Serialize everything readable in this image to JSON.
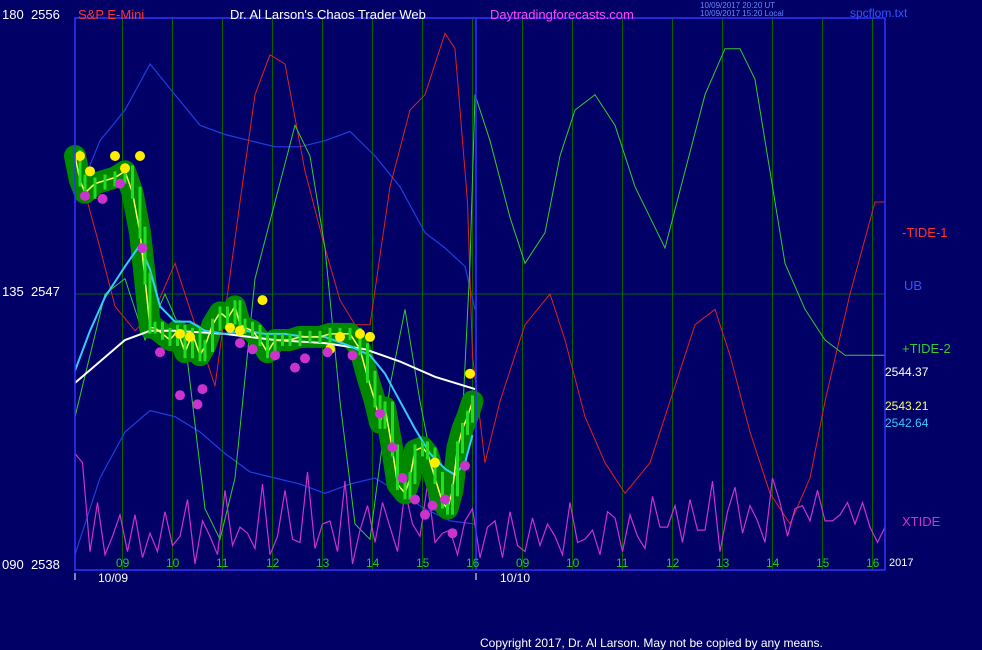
{
  "header": {
    "symbol": "S&P E-Mini",
    "publisher": "Dr. Al Larson's Chaos Trader Web",
    "site": "Daytradingforecasts.com",
    "timestamp_ut": "10/09/2017 20:20 UT",
    "timestamp_local": "10/09/2017 15:20 Local",
    "filename": "spcflom.txt"
  },
  "footer": {
    "copyright": "Copyright 2017, Dr. Al Larson. May not be copied by any means."
  },
  "colors": {
    "background": "#000066",
    "grid": "#006600",
    "frame": "#3333ff",
    "tide1": "#dd2222",
    "ub": "#1f3fdd",
    "tide2": "#33cc33",
    "xtide": "#cc33cc",
    "white_avg": "#ffffff",
    "cyan_avg": "#33ccff",
    "price": "#ffff66",
    "dot_up": "#ffee00",
    "dot_down": "#cc33cc",
    "halo": "#008800"
  },
  "chart_data": {
    "type": "line",
    "title": "S&P E-Mini",
    "y_left_ticks": [
      {
        "angle": "180",
        "price": "2556",
        "value": 2556
      },
      {
        "angle": "135",
        "price": "2547",
        "value": 2547
      },
      {
        "angle": "090",
        "price": "2538",
        "value": 2538
      }
    ],
    "ylim": [
      2538,
      2556
    ],
    "x_hour_labels": [
      "09",
      "10",
      "11",
      "12",
      "13",
      "14",
      "15",
      "16",
      "09",
      "10",
      "11",
      "12",
      "13",
      "14",
      "15",
      "16"
    ],
    "x_date_labels": [
      "10/09",
      "10/10"
    ],
    "x_end_label": "2017",
    "xlim": [
      0,
      16.2
    ],
    "series_labels": {
      "tide1": "-TIDE-1",
      "ub": "UB",
      "tide2": "+TIDE-2",
      "xtide": "XTIDE"
    },
    "price_labels": [
      {
        "text": "2544.37",
        "color": "#ffffff",
        "value": 2544.37
      },
      {
        "text": "2543.21",
        "color": "#ffff66",
        "value": 2543.21
      },
      {
        "text": "2542.64",
        "color": "#33ccff",
        "value": 2542.64
      }
    ],
    "series": {
      "price": {
        "x": [
          0,
          0.1,
          0.2,
          0.4,
          0.6,
          0.8,
          1.0,
          1.15,
          1.3,
          1.4,
          1.5,
          1.6,
          1.75,
          1.9,
          2.05,
          2.2,
          2.35,
          2.5,
          2.6,
          2.75,
          2.9,
          3.05,
          3.2,
          3.3,
          3.4,
          3.55,
          3.7,
          3.85,
          4.0,
          4.15,
          4.3,
          4.5,
          4.7,
          4.9,
          5.1,
          5.3,
          5.5,
          5.7,
          5.85,
          6.0,
          6.1,
          6.2,
          6.35,
          6.45,
          6.6,
          6.7,
          6.8,
          6.95,
          7.05,
          7.2,
          7.35,
          7.45,
          7.55,
          7.65,
          7.75,
          7.85,
          7.95
        ],
        "y": [
          2551.5,
          2550.7,
          2550.3,
          2550.6,
          2550.7,
          2550.8,
          2551.0,
          2550.3,
          2549.0,
          2547.5,
          2545.9,
          2545.9,
          2545.7,
          2545.5,
          2545.8,
          2545.1,
          2545.7,
          2545.0,
          2545.3,
          2546.0,
          2546.4,
          2546.2,
          2546.6,
          2546.0,
          2545.9,
          2545.8,
          2545.5,
          2545.1,
          2545.5,
          2545.5,
          2545.5,
          2545.6,
          2545.6,
          2545.6,
          2545.7,
          2545.7,
          2545.7,
          2545.2,
          2544.3,
          2543.5,
          2542.8,
          2543.3,
          2541.9,
          2540.8,
          2540.5,
          2541.0,
          2541.9,
          2542.0,
          2541.8,
          2541.0,
          2540.2,
          2540.0,
          2540.6,
          2542.0,
          2542.6,
          2543.0,
          2543.5
        ]
      },
      "white_avg": {
        "x": [
          0,
          0.5,
          1.0,
          1.5,
          2.0,
          3.0,
          4.0,
          5.0,
          5.8,
          6.5,
          7.2,
          8.0
        ],
        "y": [
          2544.1,
          2544.8,
          2545.5,
          2545.8,
          2545.8,
          2545.7,
          2545.5,
          2545.4,
          2545.2,
          2544.8,
          2544.3,
          2543.9
        ]
      },
      "cyan_avg": {
        "x": [
          0,
          0.3,
          0.6,
          1.0,
          1.3,
          1.5,
          1.7,
          2.0,
          2.3,
          2.6,
          3.0,
          3.4,
          3.8,
          4.2,
          4.6,
          5.0,
          5.5,
          5.9,
          6.2,
          6.5,
          6.8,
          7.1,
          7.4,
          7.6,
          7.8,
          7.95
        ],
        "y": [
          2544.5,
          2545.8,
          2546.9,
          2547.9,
          2548.6,
          2547.8,
          2546.6,
          2546.1,
          2546.1,
          2545.8,
          2545.7,
          2545.8,
          2545.7,
          2545.7,
          2545.6,
          2545.6,
          2545.3,
          2545.0,
          2544.4,
          2543.5,
          2542.6,
          2541.8,
          2541.3,
          2541.1,
          2541.5,
          2542.4
        ]
      },
      "yellow_up_dots": {
        "x": [
          0.1,
          0.3,
          0.8,
          1.0,
          1.3,
          2.1,
          2.3,
          3.1,
          3.3,
          3.75,
          5.1,
          5.3,
          5.7,
          5.9,
          7.2,
          7.9
        ],
        "y": [
          2551.5,
          2551.0,
          2551.5,
          2551.1,
          2551.5,
          2545.7,
          2545.6,
          2545.9,
          2545.8,
          2546.8,
          2545.2,
          2545.6,
          2545.7,
          2545.6,
          2541.5,
          2544.4
        ]
      },
      "magenta_down_dots": {
        "x": [
          0.2,
          0.55,
          0.9,
          1.35,
          1.7,
          2.1,
          2.45,
          2.55,
          3.3,
          3.55,
          4.0,
          4.4,
          4.6,
          5.05,
          5.55,
          6.1,
          6.35,
          6.55,
          6.8,
          7.0,
          7.15,
          7.4,
          7.55,
          7.8
        ],
        "y": [
          2550.2,
          2550.1,
          2550.6,
          2548.5,
          2545.1,
          2543.7,
          2543.4,
          2543.9,
          2545.4,
          2545.2,
          2545.0,
          2544.6,
          2544.9,
          2545.1,
          2545.0,
          2543.1,
          2542.0,
          2541.0,
          2540.3,
          2539.8,
          2540.1,
          2540.3,
          2539.2,
          2541.4
        ]
      },
      "tide1": {
        "x": [
          0,
          0.25,
          0.5,
          0.8,
          1.2,
          1.6,
          2.0,
          2.4,
          2.8,
          3.3,
          3.6,
          3.9,
          4.2,
          4.6,
          5.0,
          5.3,
          5.6,
          5.9,
          6.3,
          6.7,
          7.0,
          7.4,
          7.6,
          7.85,
          7.95,
          8.2,
          8.5,
          9.0,
          9.5,
          9.8,
          10.2,
          10.6,
          11.0,
          11.5,
          12.0,
          12.4,
          12.8,
          13.1,
          13.5,
          13.9,
          14.3,
          14.7,
          15.0,
          15.5,
          16.0,
          16.2
        ],
        "y": [
          2551.0,
          2550.0,
          2548.5,
          2546.6,
          2545.8,
          2546.5,
          2548.0,
          2546.0,
          2544.0,
          2550.0,
          2553.5,
          2554.8,
          2554.5,
          2551.0,
          2548.5,
          2546.8,
          2546.0,
          2546.0,
          2550.5,
          2553.0,
          2553.5,
          2555.5,
          2555.0,
          2550.0,
          2545.0,
          2541.5,
          2543.5,
          2546.0,
          2547.0,
          2545.5,
          2543.0,
          2541.5,
          2540.5,
          2541.5,
          2544.0,
          2546.0,
          2546.5,
          2545.0,
          2542.5,
          2540.5,
          2539.5,
          2541.0,
          2543.5,
          2547.0,
          2550.0,
          2550.0
        ]
      },
      "ub": {
        "x": [
          0,
          0.5,
          1.0,
          1.5,
          2.0,
          2.5,
          3.0,
          3.5,
          4.0,
          4.5,
          5.0,
          5.5,
          6.0,
          6.5,
          7.0,
          7.4,
          7.8,
          8.0
        ],
        "y": [
          2550.0,
          2552.0,
          2553.0,
          2554.5,
          2553.5,
          2552.5,
          2552.2,
          2552.0,
          2551.8,
          2551.8,
          2552.0,
          2552.3,
          2551.5,
          2550.5,
          2549.0,
          2548.5,
          2547.9,
          2546.5
        ]
      },
      "lb": {
        "x": [
          0,
          0.5,
          1.0,
          1.5,
          2.0,
          2.5,
          3.0,
          3.5,
          4.0,
          4.5,
          5.0,
          5.5,
          6.0,
          6.5,
          7.0,
          7.5,
          8.0
        ],
        "y": [
          2538.5,
          2541.0,
          2542.5,
          2543.2,
          2543.0,
          2542.5,
          2541.8,
          2541.2,
          2541.0,
          2540.8,
          2540.5,
          2540.8,
          2541.0,
          2540.5,
          2540.0,
          2539.6,
          2539.5
        ]
      },
      "tide2": {
        "x": [
          0,
          0.3,
          0.6,
          1.0,
          1.4,
          1.8,
          2.2,
          2.6,
          2.9,
          3.2,
          3.6,
          4.0,
          4.4,
          4.7,
          5.0,
          5.3,
          5.6,
          5.9,
          6.3,
          6.6,
          6.9,
          7.2,
          7.5,
          7.75,
          7.9,
          8.0,
          8.3,
          8.7,
          9.0,
          9.4,
          9.7,
          10.0,
          10.4,
          10.8,
          11.2,
          11.5,
          11.8,
          12.2,
          12.6,
          13.0,
          13.3,
          13.6,
          13.9,
          14.2,
          14.6,
          15.0,
          15.4,
          15.8,
          16.0,
          16.2
        ],
        "y": [
          2543.0,
          2545.0,
          2547.0,
          2547.5,
          2545.5,
          2547.0,
          2545.5,
          2540.0,
          2539.0,
          2541.0,
          2547.5,
          2550.0,
          2552.5,
          2551.5,
          2548.5,
          2543.5,
          2539.5,
          2539.0,
          2544.0,
          2546.5,
          2543.5,
          2541.0,
          2540.0,
          2543.0,
          2548.0,
          2553.5,
          2552.0,
          2549.5,
          2548.0,
          2549.0,
          2551.5,
          2553.0,
          2553.5,
          2552.5,
          2550.5,
          2549.5,
          2548.5,
          2551.0,
          2553.5,
          2555.0,
          2555.0,
          2554.0,
          2551.0,
          2548.0,
          2546.5,
          2545.5,
          2545.0,
          2545.0,
          2545.0,
          2545.0
        ]
      },
      "xtide": {
        "x": [
          0,
          0.15,
          0.3,
          0.45,
          0.6,
          0.75,
          0.9,
          1.05,
          1.2,
          1.35,
          1.5,
          1.65,
          1.8,
          1.95,
          2.1,
          2.25,
          2.4,
          2.55,
          2.7,
          2.85,
          3.0,
          3.15,
          3.3,
          3.45,
          3.6,
          3.75,
          3.9,
          4.05,
          4.2,
          4.35,
          4.5,
          4.65,
          4.8,
          4.95,
          5.1,
          5.25,
          5.4,
          5.55,
          5.7,
          5.85,
          6.0,
          6.15,
          6.3,
          6.45,
          6.6,
          6.75,
          6.9,
          7.05,
          7.2,
          7.35,
          7.5,
          7.65,
          7.8,
          7.95,
          8.1,
          8.25,
          8.4,
          8.55,
          8.7,
          8.85,
          9.0,
          9.15,
          9.3,
          9.45,
          9.6,
          9.75,
          9.9,
          10.05,
          10.2,
          10.35,
          10.5,
          10.65,
          10.8,
          10.95,
          11.1,
          11.25,
          11.4,
          11.55,
          11.7,
          11.85,
          12.0,
          12.15,
          12.3,
          12.45,
          12.6,
          12.75,
          12.9,
          13.05,
          13.2,
          13.35,
          13.5,
          13.65,
          13.8,
          13.95,
          14.1,
          14.25,
          14.4,
          14.55,
          14.7,
          14.85,
          15.0,
          15.15,
          15.3,
          15.45,
          15.6,
          15.75,
          15.9,
          16.05,
          16.2
        ],
        "y": [
          2541.8,
          2541.5,
          2538.6,
          2540.2,
          2538.5,
          2539.1,
          2539.8,
          2538.6,
          2539.8,
          2538.4,
          2539.2,
          2538.6,
          2539.9,
          2538.8,
          2539.1,
          2540.3,
          2538.2,
          2539.6,
          2539.1,
          2538.5,
          2540.6,
          2538.8,
          2539.4,
          2539.2,
          2538.7,
          2540.8,
          2538.5,
          2539.1,
          2540.6,
          2539.0,
          2538.9,
          2541.2,
          2538.7,
          2539.5,
          2539.6,
          2538.6,
          2540.9,
          2538.2,
          2539.3,
          2540.1,
          2538.9,
          2540.2,
          2539.4,
          2538.6,
          2540.6,
          2539.5,
          2539.1,
          2540.8,
          2538.9,
          2539.2,
          2539.3,
          2538.5,
          2539.6,
          2540.0,
          2538.4,
          2539.4,
          2539.6,
          2538.4,
          2539.9,
          2538.8,
          2538.6,
          2539.7,
          2538.8,
          2539.5,
          2539.1,
          2538.5,
          2540.2,
          2538.9,
          2539.0,
          2539.3,
          2538.5,
          2539.9,
          2539.7,
          2538.6,
          2539.8,
          2539.1,
          2538.7,
          2540.4,
          2539.4,
          2539.4,
          2540.1,
          2538.9,
          2540.3,
          2539.3,
          2539.3,
          2540.9,
          2538.6,
          2539.9,
          2540.7,
          2539.2,
          2540.1,
          2539.6,
          2538.9,
          2541.0,
          2540.2,
          2539.1,
          2540.0,
          2540.1,
          2539.6,
          2540.6,
          2539.6,
          2539.6,
          2539.8,
          2540.2,
          2539.5,
          2540.2,
          2539.4,
          2538.9,
          2539.4
        ]
      }
    }
  }
}
